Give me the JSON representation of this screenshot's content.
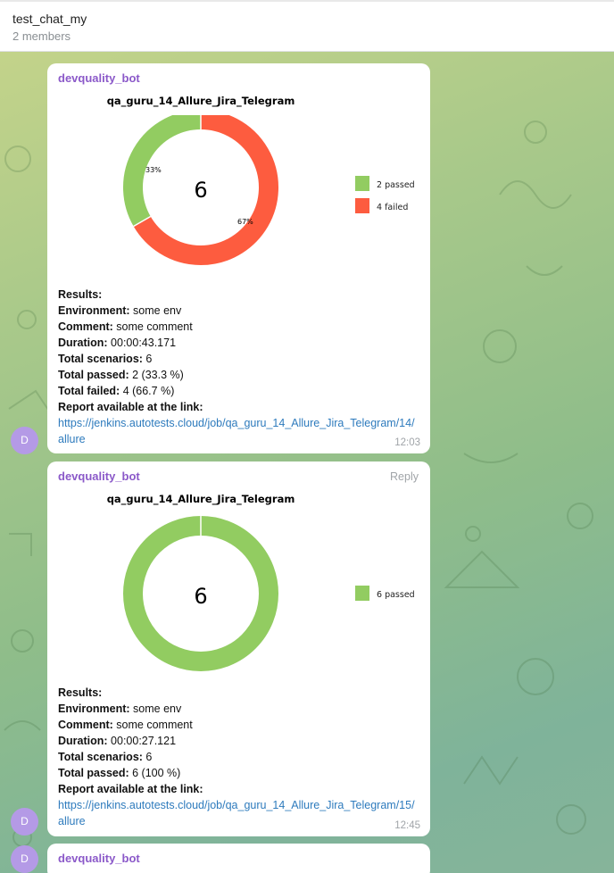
{
  "chat": {
    "title": "test_chat_my",
    "subtitle": "2 members"
  },
  "colors": {
    "passed": "#92cc61",
    "failed": "#fd5c3f",
    "sender": "#8b59c9",
    "link": "#2e7bbd",
    "avatar": "#b49ae6"
  },
  "messages": [
    {
      "sender": "devquality_bot",
      "avatar_letter": "D",
      "reply_label": "",
      "chart_title": "qa_guru_14_Allure_Jira_Telegram",
      "center_total": "6",
      "pct_labels": {
        "passed": "33%",
        "failed": "67%"
      },
      "legend": [
        {
          "label": "2 passed"
        },
        {
          "label": "4 failed"
        }
      ],
      "results_label": "Results:",
      "env_label": "Environment:",
      "env_value": " some env",
      "comment_label": "Comment:",
      "comment_value": " some comment",
      "duration_label": "Duration:",
      "duration_value": " 00:00:43.171",
      "scenarios_label": "Total scenarios:",
      "scenarios_value": " 6",
      "passed_label": "Total passed:",
      "passed_value": " 2 (33.3 %)",
      "failed_label": "Total failed:",
      "failed_value": " 4 (66.7 %)",
      "report_label": "Report available at the link:",
      "link": "https://jenkins.autotests.cloud/job/qa_guru_14_Allure_Jira_Telegram/14/allure",
      "time": "12:03"
    },
    {
      "sender": "devquality_bot",
      "avatar_letter": "D",
      "reply_label": "Reply",
      "chart_title": "qa_guru_14_Allure_Jira_Telegram",
      "center_total": "6",
      "legend": [
        {
          "label": "6 passed"
        }
      ],
      "results_label": "Results:",
      "env_label": "Environment:",
      "env_value": " some env",
      "comment_label": "Comment:",
      "comment_value": " some comment",
      "duration_label": "Duration:",
      "duration_value": " 00:00:27.121",
      "scenarios_label": "Total scenarios:",
      "scenarios_value": " 6",
      "passed_label": "Total passed:",
      "passed_value": " 6 (100 %)",
      "report_label": "Report available at the link:",
      "link": "https://jenkins.autotests.cloud/job/qa_guru_14_Allure_Jira_Telegram/15/allure",
      "time": "12:45"
    },
    {
      "sender": "devquality_bot",
      "avatar_letter": "D"
    }
  ],
  "chart_data": [
    {
      "type": "pie",
      "title": "qa_guru_14_Allure_Jira_Telegram",
      "categories": [
        "passed",
        "failed"
      ],
      "values": [
        2,
        4
      ],
      "percent_labels": [
        "33%",
        "67%"
      ],
      "center_label": "6",
      "colors": [
        "#92cc61",
        "#fd5c3f"
      ],
      "legend": [
        "2 passed",
        "4 failed"
      ],
      "legend_position": "right",
      "donut": true
    },
    {
      "type": "pie",
      "title": "qa_guru_14_Allure_Jira_Telegram",
      "categories": [
        "passed"
      ],
      "values": [
        6
      ],
      "center_label": "6",
      "colors": [
        "#92cc61"
      ],
      "legend": [
        "6 passed"
      ],
      "legend_position": "right",
      "donut": true
    }
  ]
}
